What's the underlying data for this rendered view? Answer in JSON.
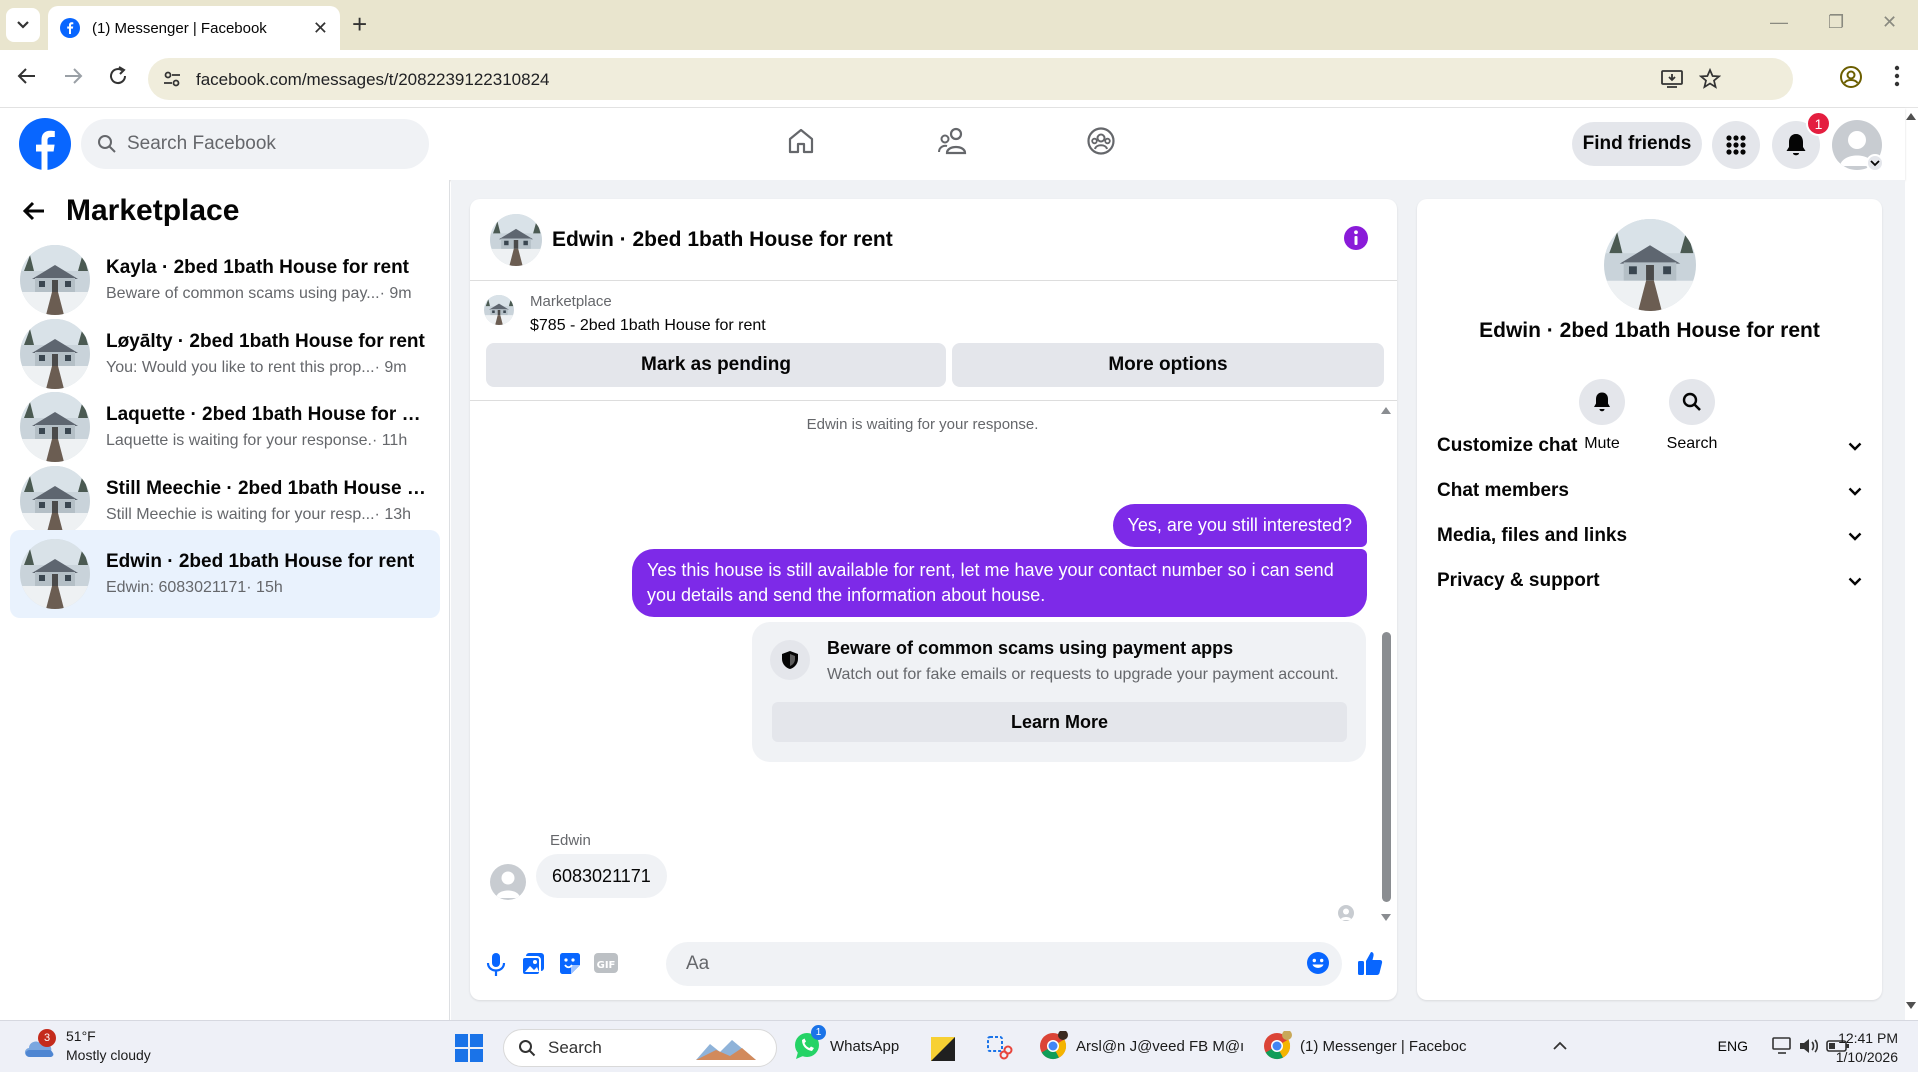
{
  "browser": {
    "tab_title": "(1) Messenger | Facebook",
    "url": "facebook.com/messages/t/2082239122310824"
  },
  "header": {
    "search_placeholder": "Search Facebook",
    "find_friends": "Find friends",
    "notification_count": "1"
  },
  "sidebar": {
    "title": "Marketplace",
    "conversations": [
      {
        "name": "Kayla · 2bed 1bath House for rent",
        "preview": "Beware of common scams using pay...",
        "time": " · 9m",
        "selected": false
      },
      {
        "name": "Løyālty · 2bed 1bath House for rent",
        "preview": "You: Would you like to rent this prop...",
        "time": " · 9m",
        "selected": false
      },
      {
        "name": "Laquette · 2bed 1bath House for re...",
        "preview": "Laquette is waiting for your response.",
        "time": " · 11h",
        "selected": false
      },
      {
        "name": "Still Meechie · 2bed 1bath House f...",
        "preview": "Still Meechie is waiting for your resp...",
        "time": " · 13h",
        "selected": false
      },
      {
        "name": "Edwin · 2bed 1bath House for rent",
        "preview": "Edwin: 6083021171",
        "time": " · 15h",
        "selected": true
      }
    ]
  },
  "chat": {
    "title": "Edwin · 2bed 1bath House for rent",
    "listing_source": "Marketplace",
    "listing_title": "$785 - 2bed 1bath House for rent",
    "mark_pending": "Mark as pending",
    "more_options": "More options",
    "waiting_notice": "Edwin is waiting for your response.",
    "outgoing": [
      "Yes, are you still interested?",
      "Yes this house is still available for rent, let me have your contact number so i can send you details and send the information about house."
    ],
    "scam_title": "Beware of common scams using payment apps",
    "scam_desc": "Watch out for fake emails or requests to upgrade your payment account.",
    "learn_more": "Learn More",
    "incoming_sender": "Edwin",
    "incoming_message": "6083021171",
    "composer_placeholder": "Aa"
  },
  "details": {
    "name": "Edwin · 2bed 1bath House for rent",
    "mute": "Mute",
    "search": "Search",
    "sections": [
      "Customize chat",
      "Chat members",
      "Media, files and links",
      "Privacy & support"
    ]
  },
  "taskbar": {
    "weather_temp": "51°F",
    "weather_desc": "Mostly cloudy",
    "weather_badge": "3",
    "search": "Search",
    "apps": [
      {
        "label": "WhatsApp",
        "badge": "1"
      },
      {
        "label": "Arsl@n J@veed FB M@ı"
      },
      {
        "label": "(1) Messenger | Faceboc"
      }
    ],
    "lang": "ENG",
    "time": "12:41 PM",
    "date": "1/10/2026"
  },
  "colors": {
    "fb_blue": "#0866ff",
    "messenger_purple": "#7d2ae8",
    "selected_bg": "#e9f2fd"
  }
}
